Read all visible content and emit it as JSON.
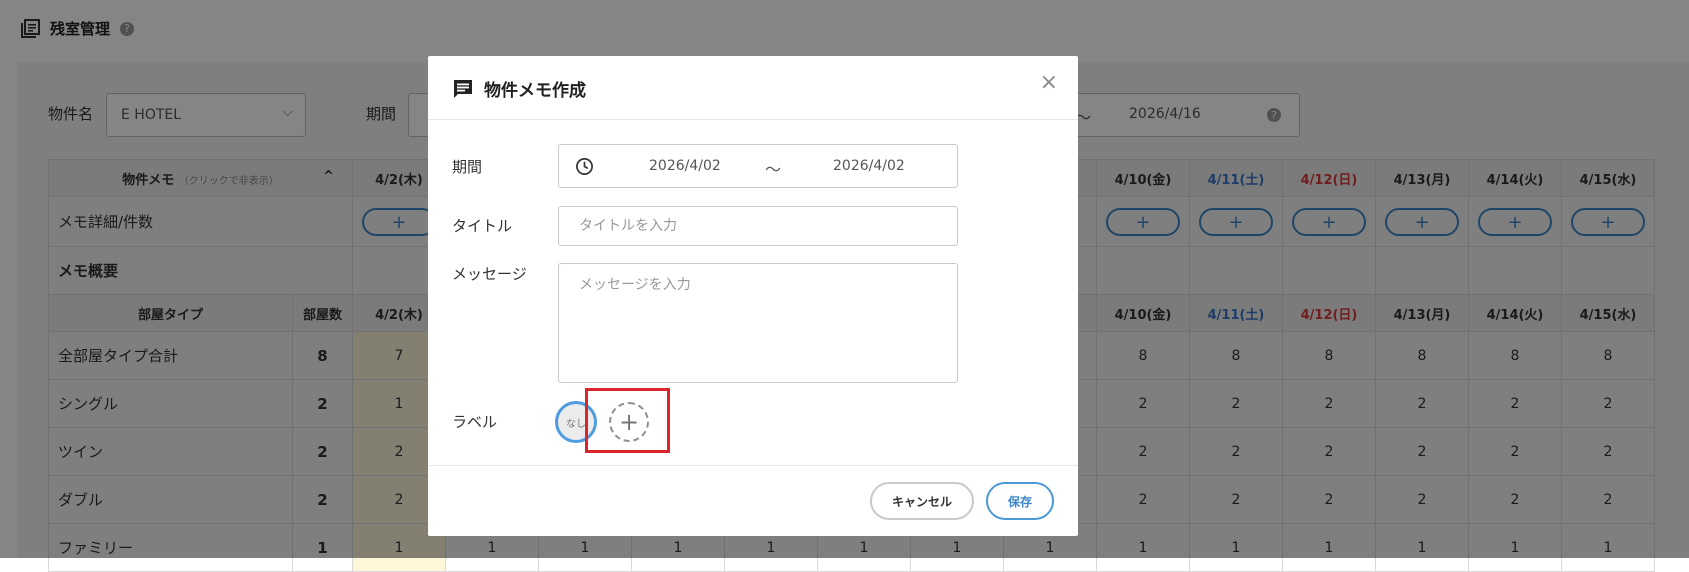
{
  "page": {
    "title": "残室管理",
    "help": "?"
  },
  "filters": {
    "property_label": "物件名",
    "property_value": "E HOTEL",
    "period_label": "期間",
    "period_sep": "〜",
    "period_end": "2026/4/16",
    "help": "?"
  },
  "table": {
    "memo_header": "物件メモ",
    "memo_header_hint": "（クリックで非表示）",
    "memo_header_toggle": "^",
    "dates": [
      "4/2(木)",
      "",
      "",
      "",
      "",
      "",
      "",
      "",
      "4/10(金)",
      "4/11(土)",
      "4/12(日)",
      "4/13(月)",
      "4/14(火)",
      "4/15(水)"
    ],
    "memo_detail_label": "メモ詳細/件数",
    "memo_add": "+",
    "memo_summary_label": "メモ概要",
    "room_type_header": "部屋タイプ",
    "room_count_header": "部屋数",
    "rows": [
      {
        "name": "全部屋タイプ合計",
        "count": "8",
        "first": "7",
        "tail": [
          "8",
          "8",
          "8",
          "8",
          "8",
          "8"
        ]
      },
      {
        "name": "シングル",
        "count": "2",
        "first": "1",
        "tail": [
          "2",
          "2",
          "2",
          "2",
          "2",
          "2"
        ]
      },
      {
        "name": "ツイン",
        "count": "2",
        "first": "2",
        "tail": [
          "2",
          "2",
          "2",
          "2",
          "2",
          "2"
        ]
      },
      {
        "name": "ダブル",
        "count": "2",
        "first": "2",
        "tail": [
          "2",
          "2",
          "2",
          "2",
          "2",
          "2"
        ]
      },
      {
        "name": "ファミリー",
        "count": "1",
        "first": "1",
        "mid": [
          "1",
          "1",
          "1",
          "1",
          "1",
          "1",
          "1"
        ],
        "tail": [
          "1",
          "1",
          "1",
          "1",
          "1",
          "1"
        ]
      }
    ]
  },
  "modal": {
    "title": "物件メモ作成",
    "close": "×",
    "period_label": "期間",
    "date_start": "2026/4/02",
    "date_sep": "〜",
    "date_end": "2026/4/02",
    "title_label": "タイトル",
    "title_placeholder": "タイトルを入力",
    "message_label": "メッセージ",
    "message_placeholder": "メッセージを入力",
    "label_label": "ラベル",
    "label_none": "なし",
    "label_add": "+",
    "cancel": "キャンセル",
    "save": "保存"
  },
  "colors": {
    "accent": "#3d86c8",
    "saturday": "#3b73c9",
    "sunday": "#d63a3a",
    "highlight": "#d9262b"
  }
}
